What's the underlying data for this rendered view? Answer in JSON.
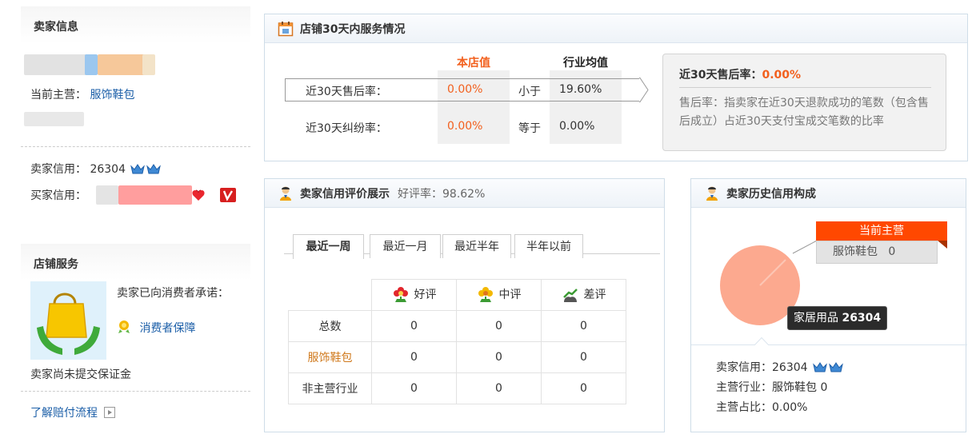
{
  "seller_info": {
    "title": "卖家信息",
    "main_business_label": "当前主营：",
    "main_business_value": "服饰鞋包",
    "seller_credit_label": "卖家信用：",
    "seller_credit_value": "26304",
    "buyer_credit_label": "买家信用："
  },
  "shop_service": {
    "title": "店铺服务",
    "promise_text": "卖家已向消费者承诺：",
    "guarantee_link": "消费者保障",
    "deposit_text": "卖家尚未提交保证金",
    "compensation_link": "了解赔付流程"
  },
  "service_panel": {
    "title": "店铺30天内服务情况",
    "col_shop": "本店值",
    "col_industry": "行业均值",
    "rows": [
      {
        "label": "近30天售后率：",
        "shop": "0.00%",
        "compare": "小于",
        "industry": "19.60%"
      },
      {
        "label": "近30天纠纷率：",
        "shop": "0.00%",
        "compare": "等于",
        "industry": "0.00%"
      }
    ],
    "tip": {
      "title_label": "近30天售后率：",
      "title_value": "0.00%",
      "description": "售后率：指卖家在近30天退款成功的笔数（包含售后成立）占近30天支付宝成交笔数的比率"
    }
  },
  "rating_panel": {
    "title": "卖家信用评价展示",
    "good_rate_label": "好评率：",
    "good_rate_value": "98.62%",
    "tabs": [
      "最近一周",
      "最近一月",
      "最近半年",
      "半年以前"
    ],
    "columns": [
      "好评",
      "中评",
      "差评"
    ],
    "rows": [
      {
        "label": "总数",
        "values": [
          "0",
          "0",
          "0"
        ]
      },
      {
        "label": "服饰鞋包",
        "values": [
          "0",
          "0",
          "0"
        ]
      },
      {
        "label": "非主营行业",
        "values": [
          "0",
          "0",
          "0"
        ]
      }
    ]
  },
  "history_panel": {
    "title": "卖家历史信用构成",
    "current_main_label": "当前主营",
    "current_main_value": "服饰鞋包",
    "current_main_count": "0",
    "pie_tooltip_label": "家居用品",
    "pie_tooltip_value": "26304",
    "seller_credit_label": "卖家信用：",
    "seller_credit_value": "26304",
    "main_industry_label": "主营行业：",
    "main_industry_value": "服饰鞋包 0",
    "main_ratio_label": "主营占比：",
    "main_ratio_value": "0.00%"
  },
  "colors": {
    "accent_orange": "#f2601e",
    "link_blue": "#1c5fa8",
    "pie_fill": "#fca98f",
    "current_main_red": "#ff4800",
    "crown_blue": "#3f89d4"
  },
  "icons": {
    "service_header": "calendar-icon",
    "rating_header": "person-icon",
    "history_header": "person-icon",
    "good": "red-flower-icon",
    "neutral": "yellow-flower-icon",
    "bad": "broken-heart-icon",
    "crown": "crown-icon",
    "guarantee": "guarantee-medal-icon",
    "bag": "shopping-bag-hands-icon"
  }
}
